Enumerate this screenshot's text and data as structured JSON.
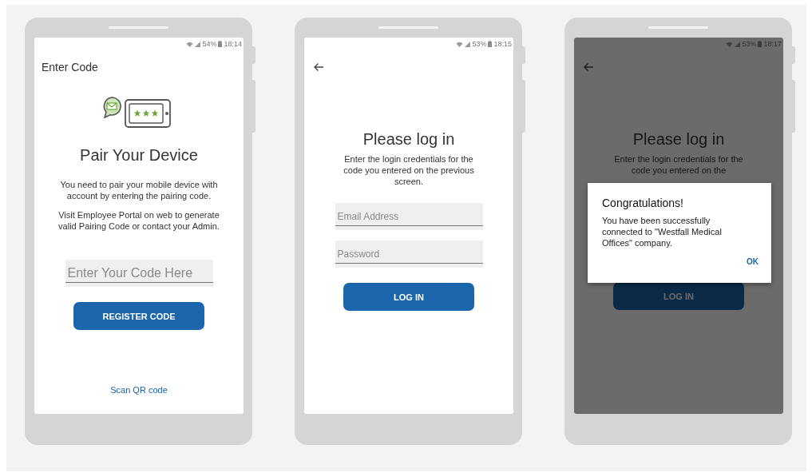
{
  "screens": [
    {
      "kind": "pair",
      "status": {
        "battery": "54%",
        "time": "18:14"
      },
      "title": "Enter Code",
      "heading": "Pair Your Device",
      "paragraphs": [
        "You need to pair your mobile device with account by entering the pairing code.",
        "Visit Employee Portal on web to generate valid Pairing Code or contact your Admin."
      ],
      "fields": [
        {
          "placeholder": "Enter Your Code Here"
        }
      ],
      "button": "REGISTER CODE",
      "link": "Scan QR code"
    },
    {
      "kind": "login",
      "status": {
        "battery": "53%",
        "time": "18:15"
      },
      "heading": "Please log in",
      "paragraphs": [
        "Enter the login credentials for the code you entered on the previous screen."
      ],
      "fields": [
        {
          "placeholder": "Email Address"
        },
        {
          "placeholder": "Password"
        }
      ],
      "button": "LOG IN"
    },
    {
      "kind": "login",
      "status": {
        "battery": "53%",
        "time": "18:17"
      },
      "heading": "Please log in",
      "paragraphs": [
        "Enter the login credentials for the code you entered on the"
      ],
      "button": "LOG IN",
      "dialog": {
        "title": "Congratulations!",
        "message": "You have been successfully connected to \"Westfall Medical Offices\" company.",
        "action": "OK"
      }
    }
  ]
}
